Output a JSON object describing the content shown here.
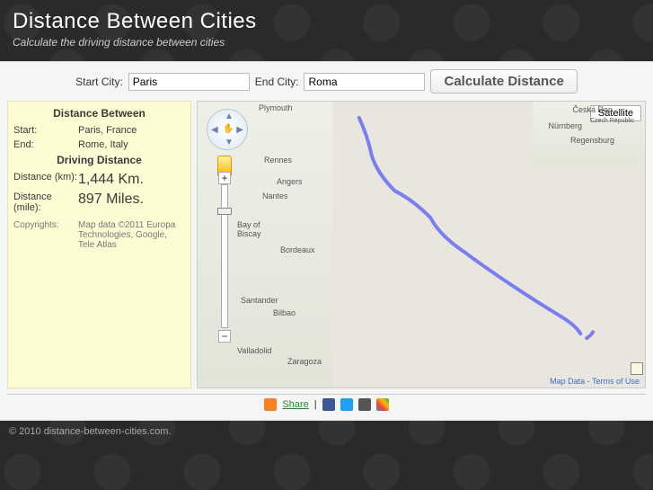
{
  "header": {
    "title": "Distance Between Cities",
    "subtitle": "Calculate the driving distance between cities"
  },
  "form": {
    "start_label": "Start City:",
    "start_value": "Paris",
    "end_label": "End City:",
    "end_value": "Roma",
    "button": "Calculate Distance"
  },
  "info": {
    "heading1": "Distance Between",
    "start_label": "Start:",
    "start_value": "Paris, France",
    "end_label": "End:",
    "end_value": "Rome, Italy",
    "heading2": "Driving Distance",
    "km_label": "Distance (km):",
    "km_value": "1,444 Km.",
    "mi_label": "Distance (mile):",
    "mi_value": "897 Miles.",
    "copy_label": "Copyrights:",
    "copy_value": "Map data ©2011 Europa Technologies, Google, Tele Atlas"
  },
  "map": {
    "satellite_btn": "Satellite",
    "cities": {
      "plymouth": "Plymouth",
      "rennes": "Rennes",
      "angers": "Angers",
      "nantes": "Nantes",
      "bay": "Bay of Biscay",
      "bordeaux": "Bordeaux",
      "santander": "Santander",
      "bilbao": "Bilbao",
      "valladolid": "Valladolid",
      "zaragoza": "Zaragoza",
      "ceska": "Česká Rep",
      "nurnberg": "Nürnberg",
      "regensburg": "Regensburg",
      "czech": "Czech Republic"
    },
    "footer_links": "Map Data - Terms of Use"
  },
  "share": {
    "link": "Share"
  },
  "footer": {
    "text": "© 2010 distance-between-cities.com."
  }
}
